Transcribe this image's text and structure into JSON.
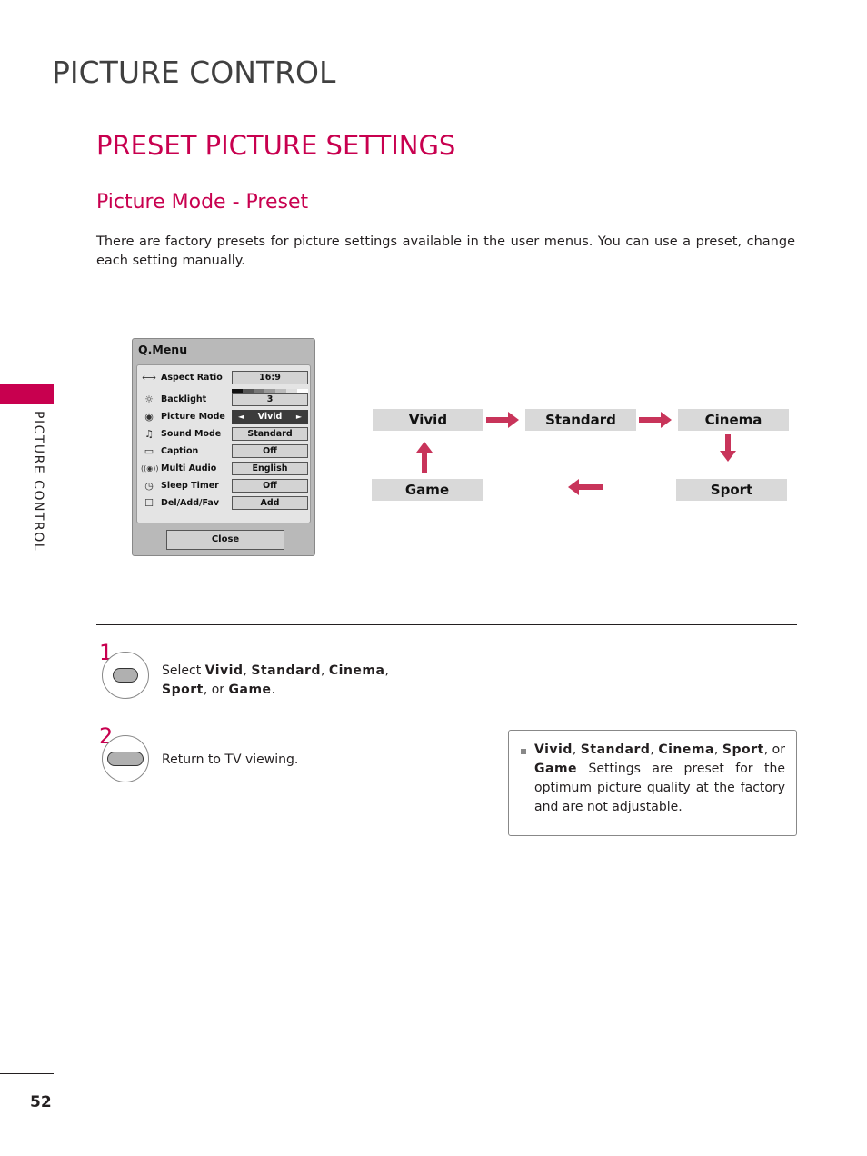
{
  "page": {
    "chapter_title": "PICTURE CONTROL",
    "section_title": "PRESET PICTURE SETTINGS",
    "subsection_title": "Picture Mode - Preset",
    "intro": "There are factory presets for picture settings available in the user menus. You can use a preset, change each setting manually.",
    "side_label": "PICTURE CONTROL",
    "page_number": "52",
    "accent_color": "#c8004f"
  },
  "qmenu": {
    "title": "Q.Menu",
    "rows": [
      {
        "icon": "aspect-ratio-icon",
        "glyph": "⟷",
        "label": "Aspect Ratio",
        "value": "16:9"
      },
      {
        "icon": "backlight-icon",
        "glyph": "☼",
        "label": "Backlight",
        "value": "3"
      },
      {
        "icon": "picture-mode-icon",
        "glyph": "◉",
        "label": "Picture Mode",
        "value": "Vivid"
      },
      {
        "icon": "sound-mode-icon",
        "glyph": "♫",
        "label": "Sound Mode",
        "value": "Standard"
      },
      {
        "icon": "caption-icon",
        "glyph": "▭",
        "label": "Caption",
        "value": "Off"
      },
      {
        "icon": "multi-audio-icon",
        "glyph": "((◉))",
        "label": "Multi Audio",
        "value": "English"
      },
      {
        "icon": "sleep-timer-icon",
        "glyph": "◷",
        "label": "Sleep Timer",
        "value": "Off"
      },
      {
        "icon": "del-add-fav-icon",
        "glyph": "☐",
        "label": "Del/Add/Fav",
        "value": "Add"
      }
    ],
    "close_label": "Close",
    "left_arrow": "◄",
    "right_arrow": "►"
  },
  "flow": {
    "modes": [
      "Vivid",
      "Standard",
      "Cinema",
      "Sport",
      "Game"
    ]
  },
  "steps": [
    {
      "number": "1",
      "prefix": "Select ",
      "items": [
        "Vivid",
        "Standard",
        "Cinema",
        "Sport",
        "Game"
      ],
      "sep1": ", ",
      "sep_or": ", or ",
      "suffix": "."
    },
    {
      "number": "2",
      "text": "Return to TV viewing."
    }
  ],
  "note": {
    "items": [
      "Vivid",
      "Standard",
      "Cinema",
      "Sport",
      "Game"
    ],
    "text": " Settings are preset for the optimum picture quality at the factory and are not adjustable."
  }
}
